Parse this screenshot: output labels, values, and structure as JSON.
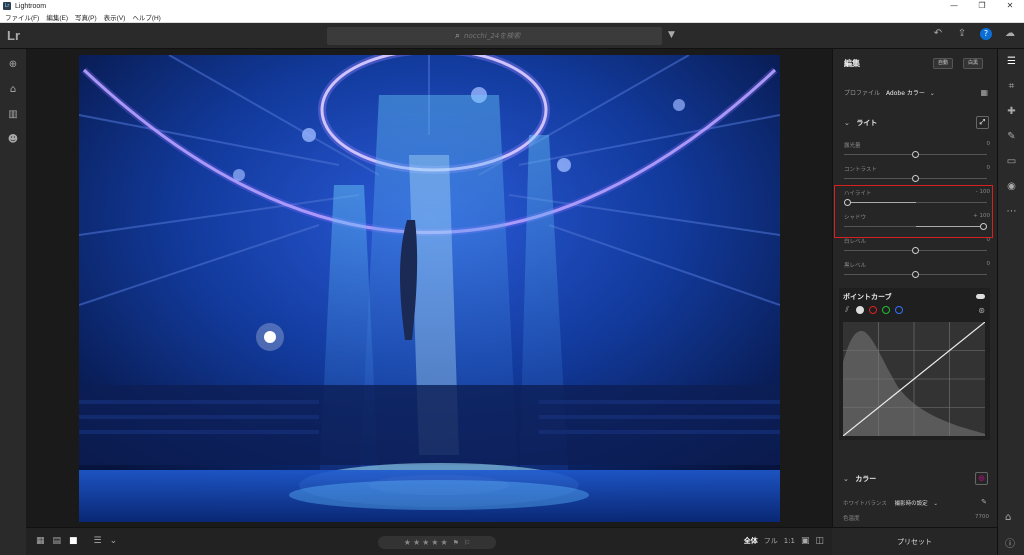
{
  "window": {
    "title": "Lightroom",
    "app_icon": "Lr",
    "controls": [
      "—",
      "❐",
      "✕"
    ]
  },
  "menu": {
    "items": [
      "ファイル(F)",
      "編集(E)",
      "写真(P)",
      "表示(V)",
      "ヘルプ(H)"
    ]
  },
  "topbar": {
    "logo": "Lr",
    "search_placeholder": "nocchi_24を検索"
  },
  "left_rail": [
    "plus-icon",
    "home-icon",
    "library-icon",
    "people-icon"
  ],
  "panel": {
    "title": "編集",
    "btn_auto": "自動",
    "btn_bw": "白黒",
    "profile_label": "プロファイル",
    "profile_value": "Adobe カラー",
    "light_section": "ライト",
    "sliders": [
      {
        "label": "露光量",
        "value": "0",
        "position": 0.5
      },
      {
        "label": "コントラスト",
        "value": "0",
        "position": 0.5
      },
      {
        "label": "ハイライト",
        "value": "- 100",
        "position": 0.0
      },
      {
        "label": "シャドウ",
        "value": "+ 100",
        "position": 1.0
      },
      {
        "label": "白レベル",
        "value": "0",
        "position": 0.5
      },
      {
        "label": "黒レベル",
        "value": "0",
        "position": 0.5
      }
    ],
    "point_curve": "ポイントカーブ",
    "color_section": "カラー",
    "wb_label": "ホワイトバランス",
    "wb_value": "撮影時の設定",
    "temp_label": "色温度",
    "temp_value": "7700"
  },
  "bottombar": {
    "stars": [
      "★",
      "★",
      "★",
      "★",
      "★"
    ],
    "zoom_fit": "全体",
    "zoom_fill": "フル",
    "zoom_11": "1:1"
  },
  "presets": "プリセット"
}
